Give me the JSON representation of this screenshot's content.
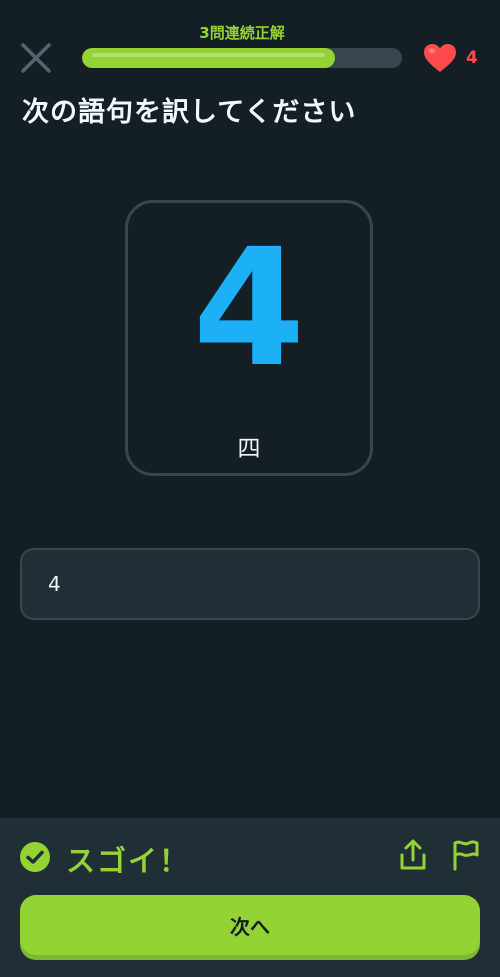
{
  "header": {
    "streak_label": "3問連続正解",
    "progress": 0.79,
    "hearts_count": "4",
    "close_icon": "close-icon",
    "heart_icon": "heart-icon"
  },
  "prompt": {
    "title": "次の語句を訳してください"
  },
  "card": {
    "numeral": "4",
    "word": "四"
  },
  "answer": {
    "value": "4"
  },
  "feedback": {
    "message": "スゴイ！",
    "check_icon": "check-circle-icon",
    "share_icon": "share-icon",
    "flag_icon": "flag-icon",
    "next_label": "次へ"
  },
  "colors": {
    "background": "#131f24",
    "accent_green": "#93d333",
    "heart_red": "#ff4b4b",
    "numeral_blue": "#1cb0f6",
    "panel": "#202f36",
    "border": "#37464f"
  }
}
